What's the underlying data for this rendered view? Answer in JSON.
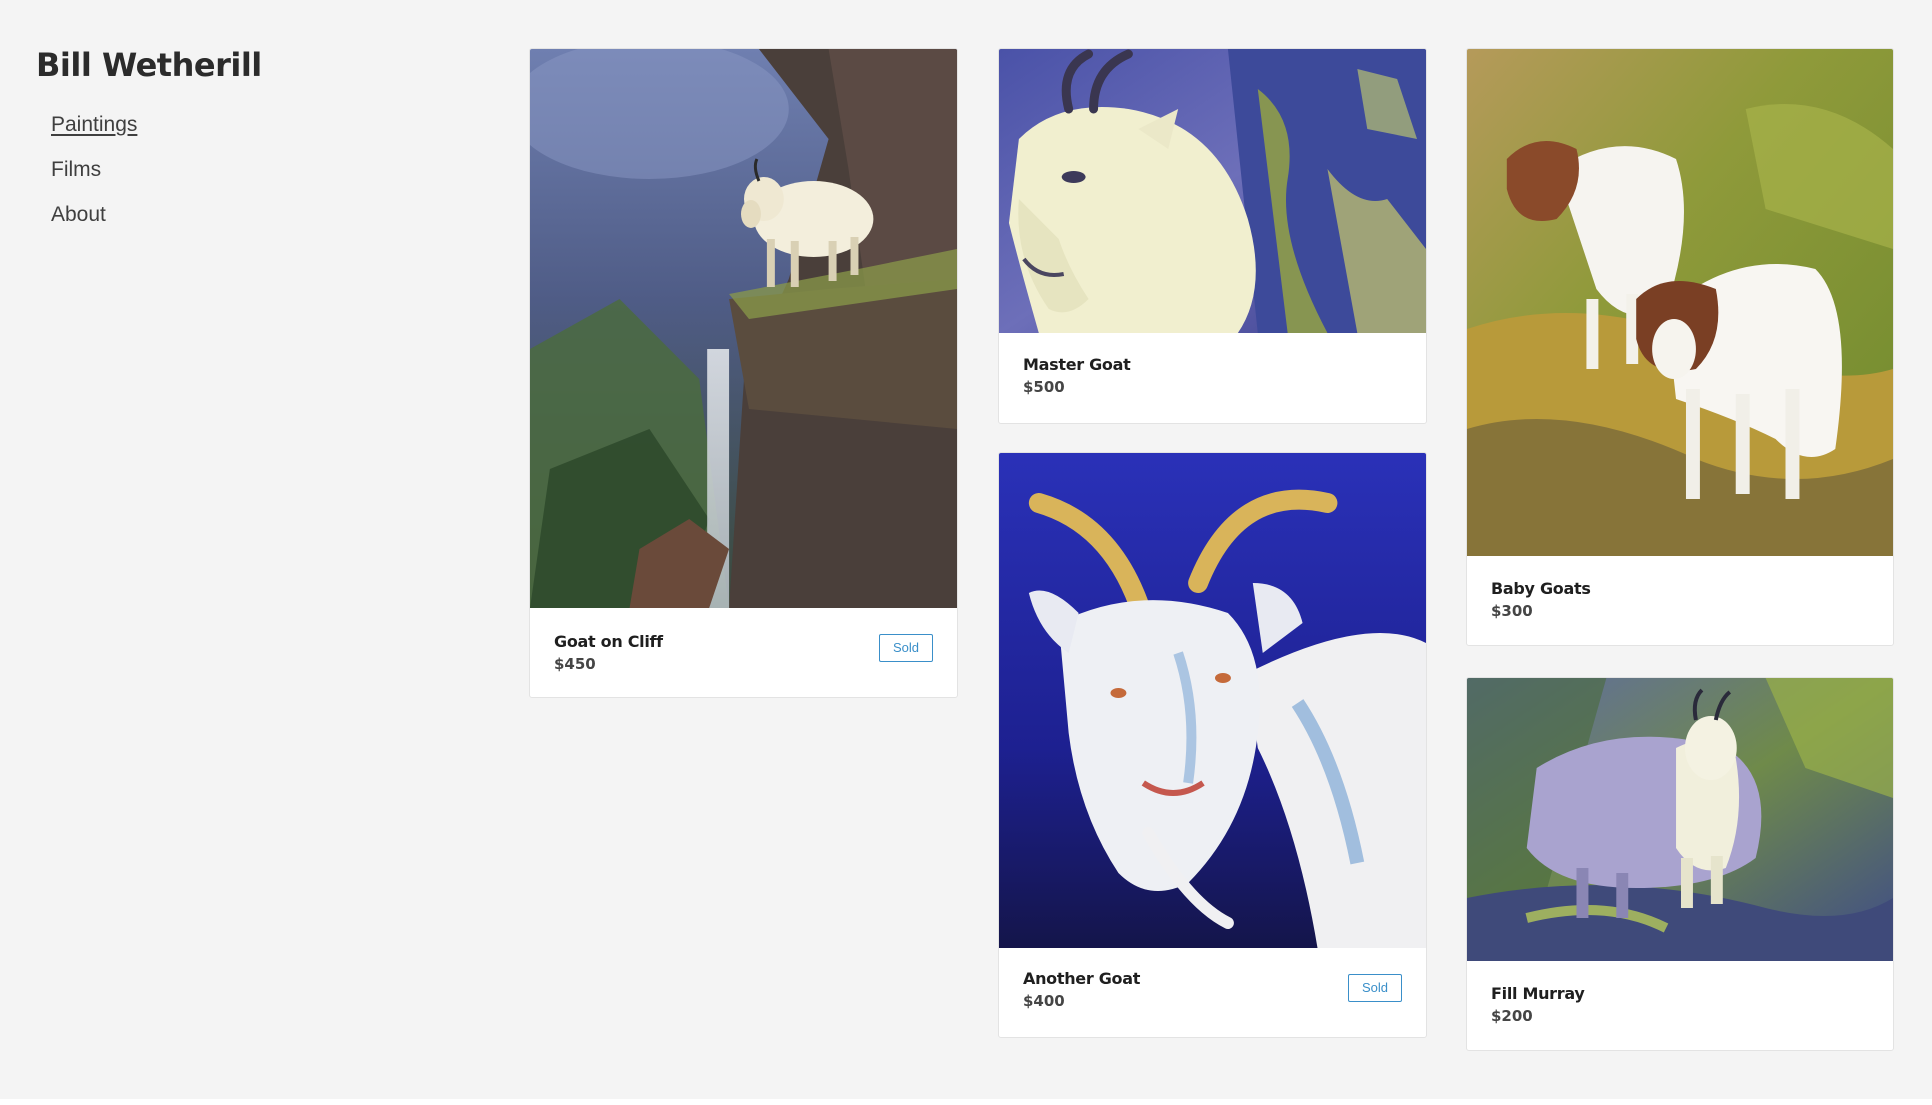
{
  "site": {
    "title": "Bill Wetherill"
  },
  "nav": {
    "items": [
      {
        "label": "Paintings",
        "active": true
      },
      {
        "label": "Films",
        "active": false
      },
      {
        "label": "About",
        "active": false
      }
    ]
  },
  "paintings": [
    {
      "name": "Goat on Cliff",
      "price": "$450",
      "status": "Sold",
      "image": "mountain goat standing on a cliff edge beside a waterfall"
    },
    {
      "name": "Master Goat",
      "price": "$500",
      "status": "",
      "image": "close-up of a white mountain goat head"
    },
    {
      "name": "Another Goat",
      "price": "$400",
      "status": "Sold",
      "image": "white goat with curved horns on a deep blue background"
    },
    {
      "name": "Baby Goats",
      "price": "$300",
      "status": "",
      "image": "two brown and white baby goats on grassy ground"
    },
    {
      "name": "Fill Murray",
      "price": "$200",
      "status": "",
      "image": "shaggy mountain goat walking on a grassy slope"
    }
  ],
  "colors": {
    "background": "#f4f4f4",
    "sold_badge": "#3a8fc9",
    "title_text": "#2b2b2b"
  }
}
